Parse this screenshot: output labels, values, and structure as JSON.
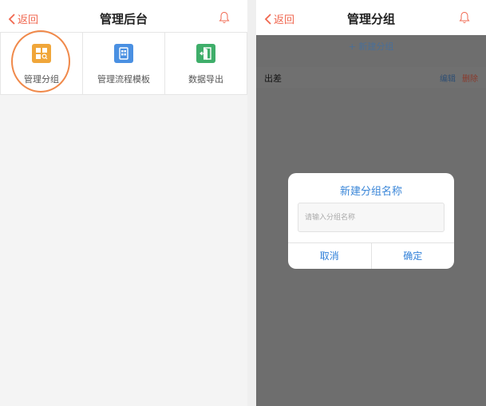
{
  "left": {
    "navbar": {
      "back_label": "返回",
      "title": "管理后台",
      "bell_icon": "bell-icon"
    },
    "grid": [
      {
        "label": "管理分组",
        "icon": "group-manage-icon",
        "color": "#f0a63a"
      },
      {
        "label": "管理流程模板",
        "icon": "template-icon",
        "color": "#4a90e2"
      },
      {
        "label": "数据导出",
        "icon": "export-icon",
        "color": "#3fae6a"
      }
    ],
    "highlight_color": "#f0894a"
  },
  "right": {
    "navbar": {
      "back_label": "返回",
      "title": "管理分组",
      "bell_icon": "bell-icon"
    },
    "new_group_label": "+ 新建分组",
    "list": [
      {
        "name": "出差",
        "edit_label": "编辑",
        "delete_label": "删除"
      }
    ],
    "dialog": {
      "title": "新建分组名称",
      "input_placeholder": "请输入分组名称",
      "input_value": "",
      "cancel_label": "取消",
      "confirm_label": "确定"
    }
  },
  "colors": {
    "accent": "#f0674f",
    "link_blue": "#2f7fd8"
  }
}
